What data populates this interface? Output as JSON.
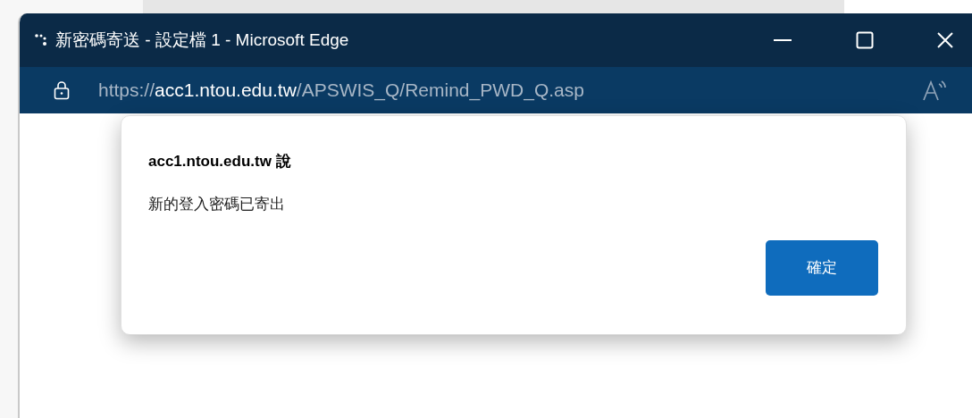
{
  "window": {
    "title": "新密碼寄送 - 設定檔 1 - Microsoft Edge"
  },
  "address_bar": {
    "url": {
      "scheme": "https://",
      "host": "acc1.ntou.edu.tw",
      "path": "/APSWIS_Q/Remind_PWD_Q.asp"
    }
  },
  "dialog": {
    "title": "acc1.ntou.edu.tw 說",
    "message": "新的登入密碼已寄出",
    "buttons": [
      "確定"
    ]
  }
}
